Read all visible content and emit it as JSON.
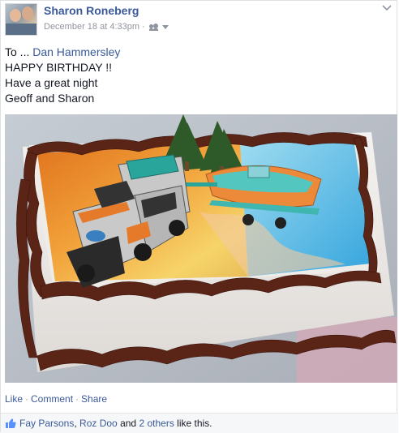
{
  "post": {
    "author": "Sharon Roneberg",
    "timestamp": "December 18 at 4:33pm",
    "audience_icon": "friends-icon",
    "message": {
      "prefix": "To ... ",
      "mention": "Dan Hammersley",
      "line2": "HAPPY BIRTHDAY !!",
      "line3": "Have a great night",
      "line4": "Geoff and Sharon"
    },
    "photo_subject": "Birthday sheet cake with toy SUV, boat and trees"
  },
  "actions": {
    "like": "Like",
    "comment": "Comment",
    "share": "Share",
    "separator": "·"
  },
  "likes": {
    "name1": "Fay Parsons",
    "comma": ",",
    "name2": "Roz Doo",
    "and": "and",
    "others": "2 others",
    "suffix": "like this."
  },
  "colors": {
    "link": "#3b5998",
    "meta": "#90949c",
    "likes_bg": "#f6f7f9"
  }
}
